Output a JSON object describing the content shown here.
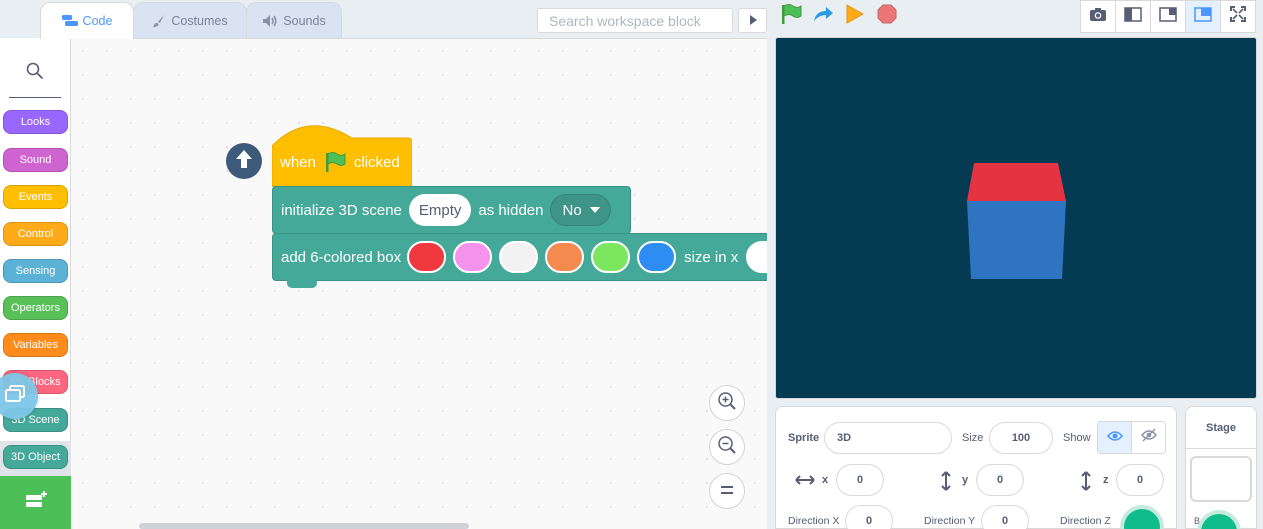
{
  "tabs": [
    {
      "label": "Code",
      "icon": "code-icon",
      "active": true
    },
    {
      "label": "Costumes",
      "icon": "brush-icon",
      "active": false
    },
    {
      "label": "Sounds",
      "icon": "speaker-icon",
      "active": false
    }
  ],
  "search": {
    "placeholder": "Search workspace block"
  },
  "controls": {
    "green_flag": "green-flag-icon",
    "turbo": "redo-arrow-icon",
    "run": "play-icon",
    "stop": "stop-icon"
  },
  "categories": [
    {
      "label": "Looks",
      "color": "#9966ff"
    },
    {
      "label": "Sound",
      "color": "#cf63cf"
    },
    {
      "label": "Events",
      "color": "#ffbf00"
    },
    {
      "label": "Control",
      "color": "#ffab19"
    },
    {
      "label": "Sensing",
      "color": "#5cb1d6"
    },
    {
      "label": "Operators",
      "color": "#59c059"
    },
    {
      "label": "Variables",
      "color": "#ff8c1a"
    },
    {
      "label": "My Blocks",
      "color": "#ff6680"
    },
    {
      "label": "3D Scene",
      "color": "#45a99a"
    },
    {
      "label": "3D Object",
      "color": "#45a99a"
    }
  ],
  "script": {
    "hat": {
      "when": "when",
      "clicked": "clicked"
    },
    "init": {
      "text": "initialize 3D scene",
      "scene_value": "Empty",
      "hidden_label": "as hidden",
      "hidden_value": "No"
    },
    "box": {
      "text": "add 6-colored box",
      "colors": [
        "#f0393e",
        "#f593ec",
        "#f2f2f2",
        "#f58a4e",
        "#7ce65f",
        "#2d8df2"
      ],
      "size_label": "size in x"
    }
  },
  "stage": {
    "cube_top_color": "#e43442",
    "cube_front_color": "#2f74c0",
    "background": "#043a52"
  },
  "sprite": {
    "sprite_label": "Sprite",
    "name": "3D",
    "size_label": "Size",
    "size": "100",
    "show_label": "Show",
    "x_label": "x",
    "x": "0",
    "y_label": "y",
    "y": "0",
    "z_label": "z",
    "z": "0",
    "dir_x_label": "Direction X",
    "dir_x": "0",
    "dir_y_label": "Direction Y",
    "dir_y": "0",
    "dir_z_label": "Direction Z"
  },
  "stage_panel": {
    "title": "Stage",
    "backdrops_label": "Backdrops"
  }
}
